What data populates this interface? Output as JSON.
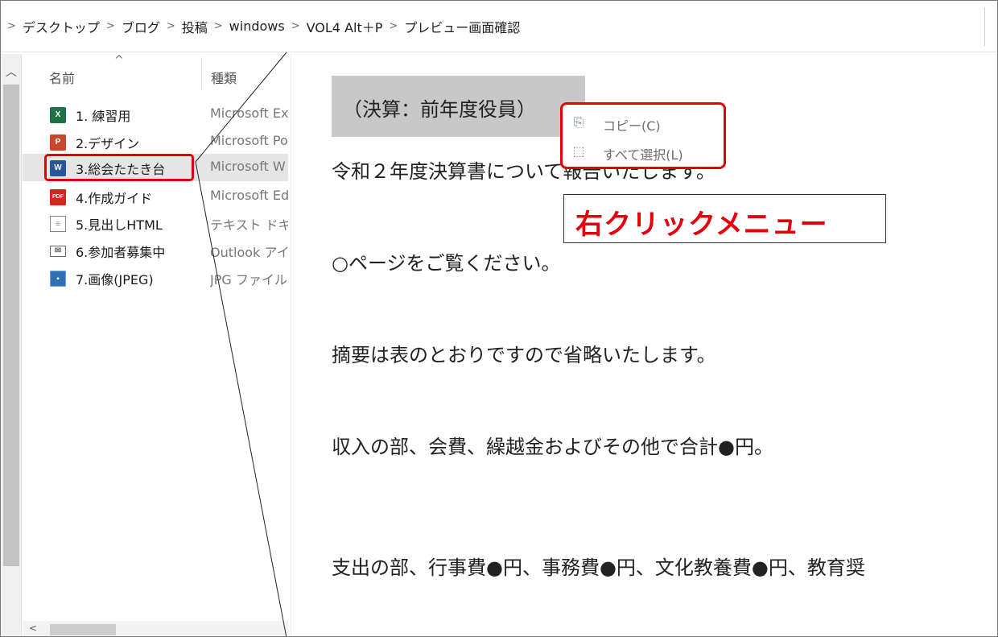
{
  "breadcrumb": {
    "separator": ">",
    "items": [
      "デスクトップ",
      "ブログ",
      "投稿",
      "windows",
      "VOL4 Alt＋P",
      "プレビュー画面確認"
    ]
  },
  "file_list": {
    "sort_indicator": "^",
    "columns": {
      "name": "名前",
      "type": "種類"
    },
    "rows": [
      {
        "name": "1. 練習用",
        "type": "Microsoft Ex",
        "icon": "excel-icon"
      },
      {
        "name": "2.デザイン",
        "type": "Microsoft Po",
        "icon": "powerpoint-icon"
      },
      {
        "name": "3.総会たたき台",
        "type": "Microsoft W",
        "icon": "word-icon",
        "selected": true
      },
      {
        "name": "4.作成ガイド",
        "type": "Microsoft Ed",
        "icon": "pdf-icon"
      },
      {
        "name": "5.見出しHTML",
        "type": "テキスト ドキュ",
        "icon": "text-file-icon"
      },
      {
        "name": "6.参加者募集中",
        "type": "Outlook アイ",
        "icon": "mail-icon"
      },
      {
        "name": "7.画像(JPEG)",
        "type": "JPG ファイル",
        "icon": "image-icon"
      }
    ]
  },
  "preview": {
    "title": "（決算：前年度役員）",
    "lines": [
      "令和２年度決算書について報告いたします。",
      "○ページをご覧ください。",
      "摘要は表のとおりですので省略いたします。",
      "収入の部、会費、繰越金およびその他で合計●円。",
      "支出の部、行事費●円、事務費●円、文化教養費●円、教育奨"
    ]
  },
  "context_menu": {
    "items": [
      {
        "label": "コピー(C)",
        "icon": "copy-icon"
      },
      {
        "label": "すべて選択(L)",
        "icon": "select-all-icon"
      }
    ]
  },
  "annotation": {
    "text": "右クリックメニュー"
  },
  "colors": {
    "highlight": "#e3000b",
    "selection": "#e5e5e5"
  }
}
